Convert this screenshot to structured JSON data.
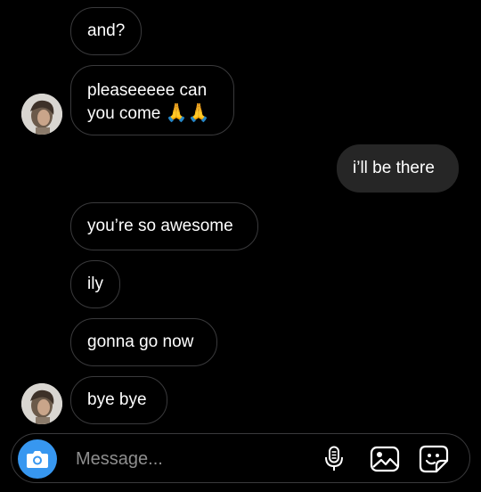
{
  "thread": {
    "messages": [
      {
        "id": "m1",
        "direction": "incoming",
        "text": "and?"
      },
      {
        "id": "m2",
        "direction": "incoming",
        "lines": [
          "pleaseeeee can",
          "you come"
        ],
        "emoji": "🙏🙏"
      },
      {
        "id": "m3",
        "direction": "outgoing",
        "text": "i’ll be there"
      },
      {
        "id": "m4",
        "direction": "incoming",
        "text": "you’re so awesome"
      },
      {
        "id": "m5",
        "direction": "incoming",
        "text": "ily"
      },
      {
        "id": "m6",
        "direction": "incoming",
        "text": "gonna go now"
      },
      {
        "id": "m7",
        "direction": "incoming",
        "text": "bye bye"
      }
    ]
  },
  "composer": {
    "placeholder": "Message...",
    "icons": {
      "camera": "camera-icon",
      "mic": "microphone-icon",
      "gallery": "image-gallery-icon",
      "sticker": "sticker-icon"
    }
  },
  "colors": {
    "background": "#000000",
    "incoming_border": "#3a3a3c",
    "outgoing_bubble": "#262626",
    "accent": "#3797f0",
    "placeholder": "#8e8e8e"
  }
}
